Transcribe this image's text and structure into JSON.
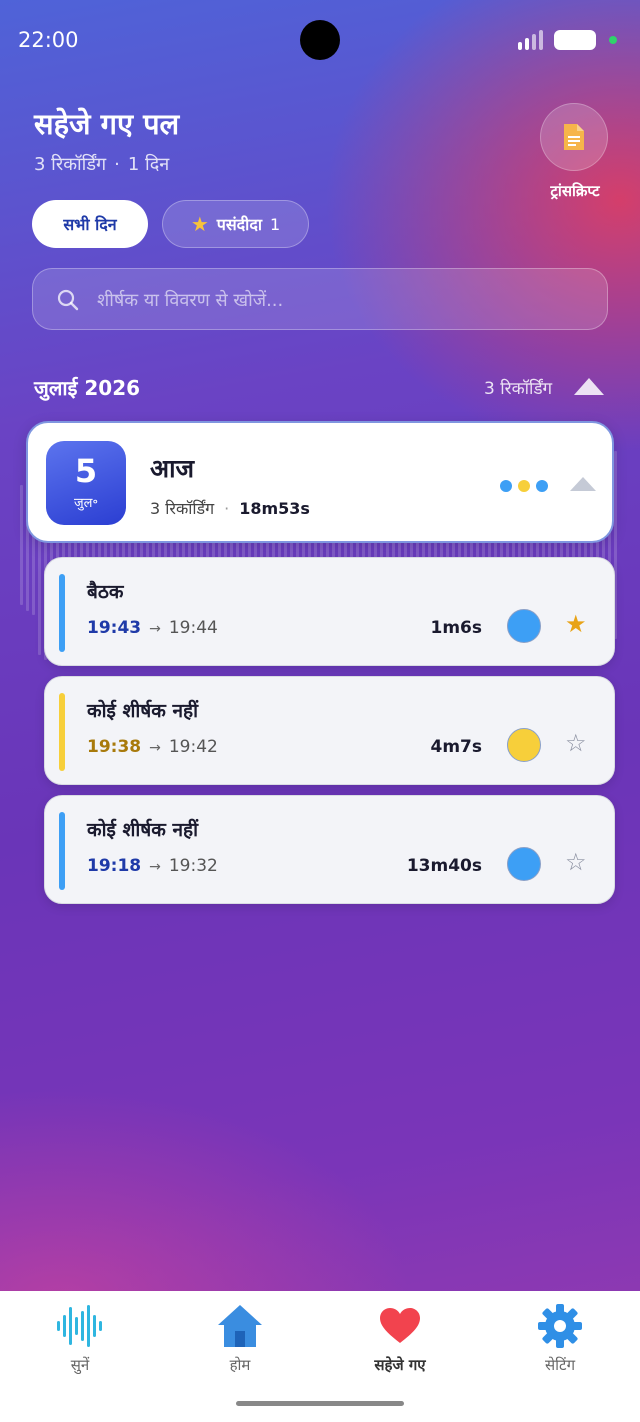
{
  "status_bar": {
    "time": "22:00"
  },
  "header": {
    "title": "सहेजे गए पल",
    "recording_count": "3 रिकॉर्डिंग",
    "separator": "·",
    "day_count": "1 दिन",
    "transcript_label": "ट्रांसक्रिप्ट",
    "transcript_icon": "document-icon"
  },
  "filters": {
    "all_days": "सभी दिन",
    "favorites_label": "पसंदीदा",
    "favorites_count": "1"
  },
  "search": {
    "placeholder": "शीर्षक या विवरण से खोजें..."
  },
  "month_section": {
    "label": "जुलाई 2026",
    "count": "3 रिकॉर्डिंग"
  },
  "day_group": {
    "day_number": "5",
    "month_abbr": "जुल॰",
    "title": "आज",
    "recording_count": "3 रिकॉर्डिंग",
    "separator": "·",
    "total_duration": "18m53s",
    "dot_colors": [
      "#3d9ff5",
      "#f7cf3a",
      "#3d9ff5"
    ]
  },
  "recordings": [
    {
      "title": "बैठक",
      "start": "19:43",
      "arrow": "→",
      "end": "19:44",
      "duration": "1m6s",
      "color": "#3d9ff5",
      "start_color": "#1f3aa8",
      "favorite": true,
      "star": "★"
    },
    {
      "title": "कोई शीर्षक नहीं",
      "start": "19:38",
      "arrow": "→",
      "end": "19:42",
      "duration": "4m7s",
      "color": "#f7cf3a",
      "start_color": "#a87a0c",
      "favorite": false,
      "star": "☆"
    },
    {
      "title": "कोई शीर्षक नहीं",
      "start": "19:18",
      "arrow": "→",
      "end": "19:32",
      "duration": "13m40s",
      "color": "#3d9ff5",
      "start_color": "#1f3aa8",
      "favorite": false,
      "star": "☆"
    }
  ],
  "bottom_nav": [
    {
      "label": "सुनें",
      "icon": "waveform-icon"
    },
    {
      "label": "होम",
      "icon": "home-icon"
    },
    {
      "label": "सहेजे गए",
      "icon": "heart-icon",
      "active": true
    },
    {
      "label": "सेटिंग",
      "icon": "gear-icon"
    }
  ]
}
